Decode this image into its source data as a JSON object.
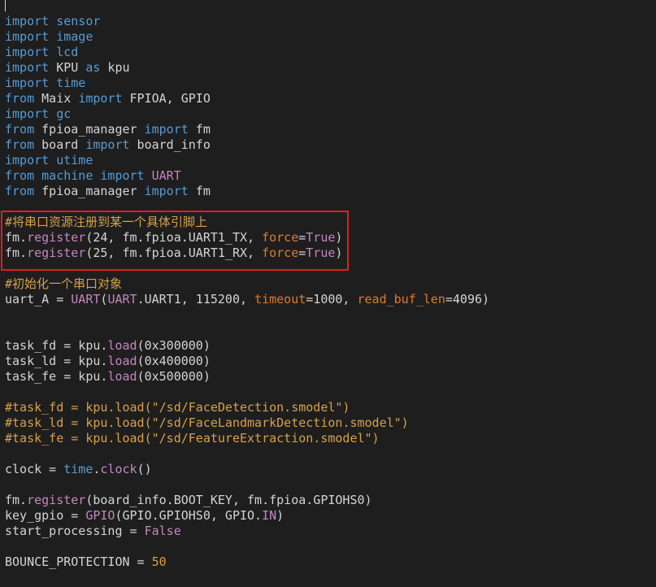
{
  "colors": {
    "background": "#1e1e1e",
    "keyword": "#569cd6",
    "identifier": "#d4d4d4",
    "function": "#c586c0",
    "comment": "#d7a04b",
    "argument": "#e3782b",
    "highlight_border": "#e21d1d"
  },
  "lines": [
    [
      {
        "t": "import",
        "c": "kw"
      },
      {
        "t": " ",
        "c": "id"
      },
      {
        "t": "sensor",
        "c": "kw"
      }
    ],
    [
      {
        "t": "import",
        "c": "kw"
      },
      {
        "t": " ",
        "c": "id"
      },
      {
        "t": "image",
        "c": "kw"
      }
    ],
    [
      {
        "t": "import",
        "c": "kw"
      },
      {
        "t": " ",
        "c": "id"
      },
      {
        "t": "lcd",
        "c": "kw"
      }
    ],
    [
      {
        "t": "import",
        "c": "kw"
      },
      {
        "t": " KPU ",
        "c": "id"
      },
      {
        "t": "as",
        "c": "kw"
      },
      {
        "t": " kpu",
        "c": "id"
      }
    ],
    [
      {
        "t": "import",
        "c": "kw"
      },
      {
        "t": " ",
        "c": "id"
      },
      {
        "t": "time",
        "c": "kw"
      }
    ],
    [
      {
        "t": "from",
        "c": "kw"
      },
      {
        "t": " Maix ",
        "c": "id"
      },
      {
        "t": "import",
        "c": "kw"
      },
      {
        "t": " FPIOA, GPIO",
        "c": "id"
      }
    ],
    [
      {
        "t": "import",
        "c": "kw"
      },
      {
        "t": " ",
        "c": "id"
      },
      {
        "t": "gc",
        "c": "kw"
      }
    ],
    [
      {
        "t": "from",
        "c": "kw"
      },
      {
        "t": " fpioa_manager ",
        "c": "id"
      },
      {
        "t": "import",
        "c": "kw"
      },
      {
        "t": " fm",
        "c": "id"
      }
    ],
    [
      {
        "t": "from",
        "c": "kw"
      },
      {
        "t": " board ",
        "c": "id"
      },
      {
        "t": "import",
        "c": "kw"
      },
      {
        "t": " board_info",
        "c": "id"
      }
    ],
    [
      {
        "t": "import",
        "c": "kw"
      },
      {
        "t": " ",
        "c": "id"
      },
      {
        "t": "utime",
        "c": "kw"
      }
    ],
    [
      {
        "t": "from",
        "c": "kw"
      },
      {
        "t": " ",
        "c": "id"
      },
      {
        "t": "machine",
        "c": "kw"
      },
      {
        "t": " ",
        "c": "id"
      },
      {
        "t": "import",
        "c": "kw"
      },
      {
        "t": " ",
        "c": "id"
      },
      {
        "t": "UART",
        "c": "cls"
      }
    ],
    [
      {
        "t": "from",
        "c": "kw"
      },
      {
        "t": " fpioa_manager ",
        "c": "id"
      },
      {
        "t": "import",
        "c": "kw"
      },
      {
        "t": " fm",
        "c": "id"
      }
    ],
    [],
    [
      {
        "t": "#将串口资源注册到某一个具体引脚上",
        "c": "cm"
      }
    ],
    [
      {
        "t": "fm.",
        "c": "id"
      },
      {
        "t": "register",
        "c": "fn"
      },
      {
        "t": "(24, fm.fpioa.UART1_TX, ",
        "c": "id"
      },
      {
        "t": "force",
        "c": "arg"
      },
      {
        "t": "=",
        "c": "id"
      },
      {
        "t": "True",
        "c": "fn"
      },
      {
        "t": ")",
        "c": "id"
      }
    ],
    [
      {
        "t": "fm.",
        "c": "id"
      },
      {
        "t": "register",
        "c": "fn"
      },
      {
        "t": "(25, fm.fpioa.UART1_RX, ",
        "c": "id"
      },
      {
        "t": "force",
        "c": "arg"
      },
      {
        "t": "=",
        "c": "id"
      },
      {
        "t": "True",
        "c": "fn"
      },
      {
        "t": ")",
        "c": "id"
      }
    ],
    [],
    [
      {
        "t": "#初始化一个串口对象",
        "c": "cm"
      }
    ],
    [
      {
        "t": "uart_A = ",
        "c": "id"
      },
      {
        "t": "UART",
        "c": "fn"
      },
      {
        "t": "(",
        "c": "id"
      },
      {
        "t": "UART",
        "c": "fn"
      },
      {
        "t": ".UART1, 115200, ",
        "c": "id"
      },
      {
        "t": "timeout",
        "c": "arg"
      },
      {
        "t": "=1000, ",
        "c": "id"
      },
      {
        "t": "read_buf_len",
        "c": "arg"
      },
      {
        "t": "=4096)",
        "c": "id"
      }
    ],
    [],
    [],
    [
      {
        "t": "task_fd = kpu.",
        "c": "id"
      },
      {
        "t": "load",
        "c": "fn"
      },
      {
        "t": "(0x300000)",
        "c": "id"
      }
    ],
    [
      {
        "t": "task_ld = kpu.",
        "c": "id"
      },
      {
        "t": "load",
        "c": "fn"
      },
      {
        "t": "(0x400000)",
        "c": "id"
      }
    ],
    [
      {
        "t": "task_fe = kpu.",
        "c": "id"
      },
      {
        "t": "load",
        "c": "fn"
      },
      {
        "t": "(0x500000)",
        "c": "id"
      }
    ],
    [],
    [
      {
        "t": "#task_fd = kpu.load(\"/sd/FaceDetection.smodel\")",
        "c": "cm"
      }
    ],
    [
      {
        "t": "#task_ld = kpu.load(\"/sd/FaceLandmarkDetection.smodel\")",
        "c": "cm"
      }
    ],
    [
      {
        "t": "#task_fe = kpu.load(\"/sd/FeatureExtraction.smodel\")",
        "c": "cm"
      }
    ],
    [],
    [
      {
        "t": "clock = ",
        "c": "id"
      },
      {
        "t": "time",
        "c": "kw"
      },
      {
        "t": ".",
        "c": "id"
      },
      {
        "t": "clock",
        "c": "fn"
      },
      {
        "t": "()",
        "c": "id"
      }
    ],
    [],
    [
      {
        "t": "fm.",
        "c": "id"
      },
      {
        "t": "register",
        "c": "fn"
      },
      {
        "t": "(board_info.BOOT_KEY, fm.fpioa.GPIOHS0)",
        "c": "id"
      }
    ],
    [
      {
        "t": "key_gpio = ",
        "c": "id"
      },
      {
        "t": "GPIO",
        "c": "fn"
      },
      {
        "t": "(GPIO.GPIOHS0, GPIO.",
        "c": "id"
      },
      {
        "t": "IN",
        "c": "fn"
      },
      {
        "t": ")",
        "c": "id"
      }
    ],
    [
      {
        "t": "start_processing = ",
        "c": "id"
      },
      {
        "t": "False",
        "c": "fn"
      }
    ],
    [],
    [
      {
        "t": "BOUNCE_PROTECTION = ",
        "c": "id"
      },
      {
        "t": "50",
        "c": "cm"
      }
    ]
  ]
}
